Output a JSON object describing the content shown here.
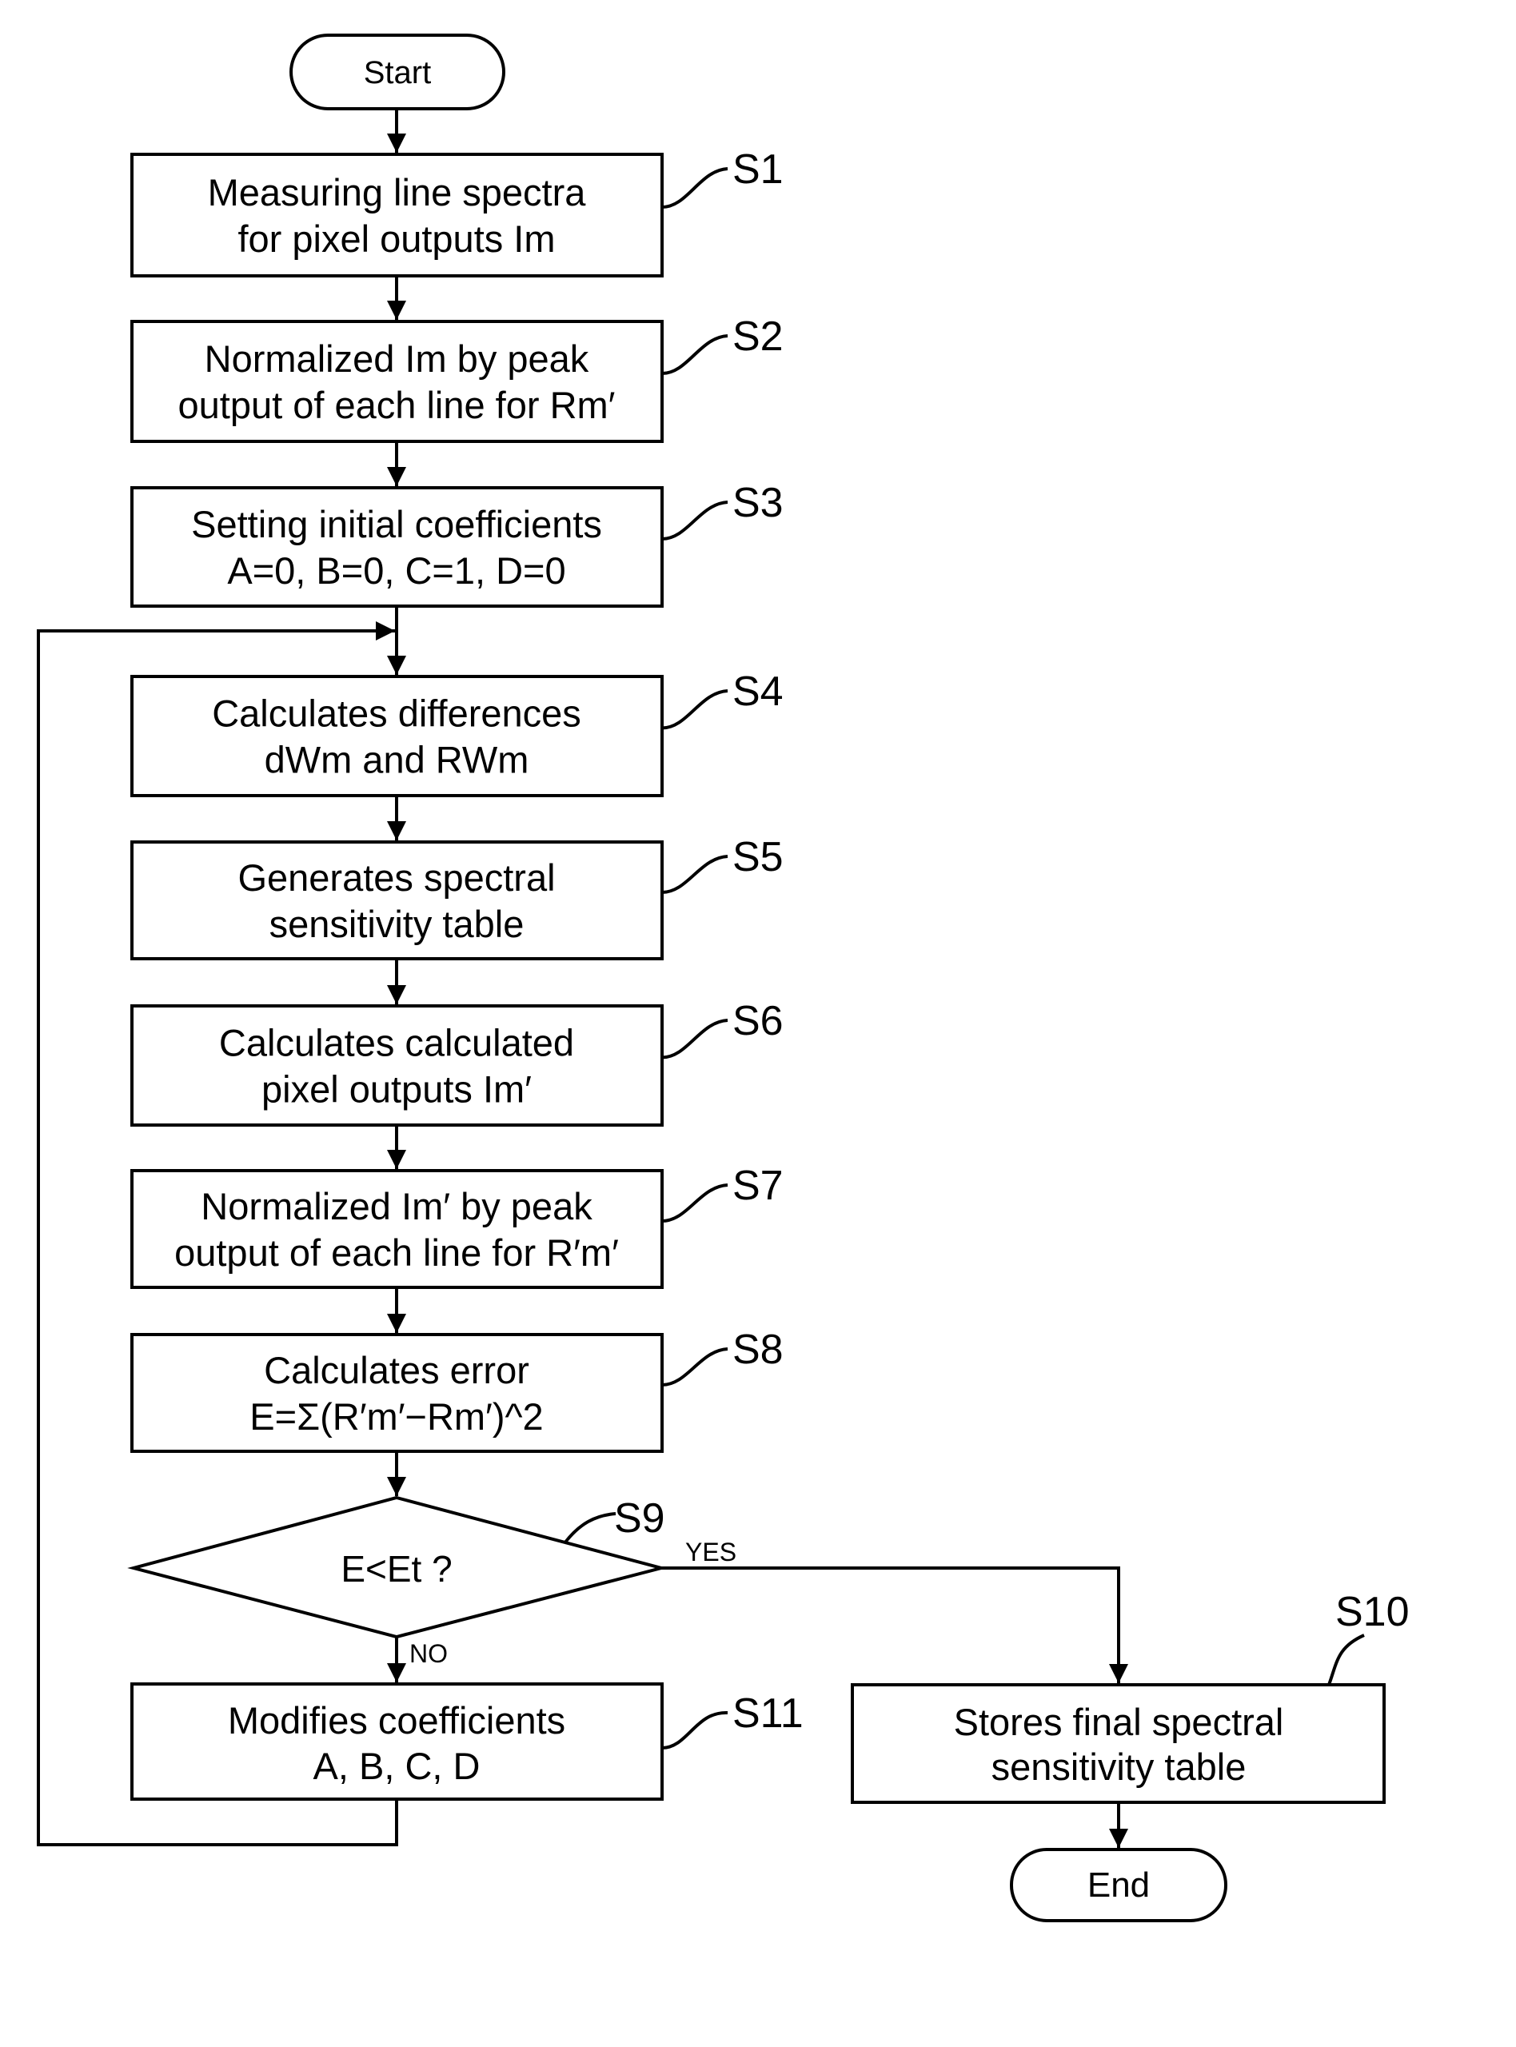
{
  "terminals": {
    "start": "Start",
    "end": "End"
  },
  "steps": [
    {
      "id": "S1",
      "lines": [
        "Measuring line spectra",
        "for pixel outputs Im"
      ]
    },
    {
      "id": "S2",
      "lines": [
        "Normalized Im by peak",
        "output of each line for Rm′"
      ]
    },
    {
      "id": "S3",
      "lines": [
        "Setting initial coefficients",
        "A=0, B=0, C=1, D=0"
      ]
    },
    {
      "id": "S4",
      "lines": [
        "Calculates differences",
        "dWm and RWm"
      ]
    },
    {
      "id": "S5",
      "lines": [
        "Generates spectral",
        "sensitivity table"
      ]
    },
    {
      "id": "S6",
      "lines": [
        "Calculates calculated",
        "pixel outputs Im′"
      ]
    },
    {
      "id": "S7",
      "lines": [
        "Normalized Im′ by peak",
        "output of each line for R′m′"
      ]
    },
    {
      "id": "S8",
      "lines": [
        "Calculates error",
        "E=Σ(R′m′−Rm′)^2"
      ]
    }
  ],
  "decision": {
    "id": "S9",
    "text": "E<Et ?",
    "yes_label": "YES",
    "no_label": "NO"
  },
  "modify_step": {
    "id": "S11",
    "lines": [
      "Modifies coefficients",
      "A, B, C, D"
    ]
  },
  "final_step": {
    "id": "S10",
    "lines": [
      "Stores final spectral",
      "sensitivity table"
    ]
  }
}
